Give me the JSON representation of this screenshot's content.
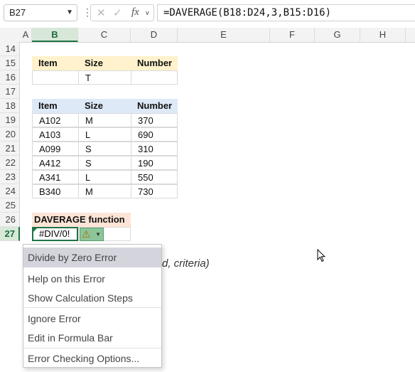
{
  "namebox": {
    "value": "B27"
  },
  "formula_bar": {
    "formula": "=DAVERAGE(B18:D24,3,B15:D16)",
    "fx_label": "fx"
  },
  "columns": [
    "A",
    "B",
    "C",
    "D",
    "E",
    "F",
    "G",
    "H"
  ],
  "rows": [
    "14",
    "15",
    "16",
    "17",
    "18",
    "19",
    "20",
    "21",
    "22",
    "23",
    "24",
    "25",
    "26",
    "27"
  ],
  "criteria_table": {
    "headers": [
      "Item",
      "Size",
      "Number"
    ],
    "row": [
      "",
      "T",
      ""
    ]
  },
  "data_table": {
    "headers": [
      "Item",
      "Size",
      "Number"
    ],
    "rows": [
      [
        "A102",
        "M",
        "370"
      ],
      [
        "A103",
        "L",
        "690"
      ],
      [
        "A099",
        "S",
        "310"
      ],
      [
        "A412",
        "S",
        "190"
      ],
      [
        "A341",
        "L",
        "550"
      ],
      [
        "B340",
        "M",
        "730"
      ]
    ]
  },
  "function_label": "DAVERAGE function",
  "active_cell_value": "#DIV/0!",
  "background_text": "d, criteria)",
  "error_menu": {
    "title": "Divide by Zero Error",
    "items": [
      "Help on this Error",
      "Show Calculation Steps",
      "Ignore Error",
      "Edit in Formula Bar",
      "Error Checking Options..."
    ]
  },
  "colors": {
    "accent": "#217346",
    "criteria_header": "#fff2cc",
    "data_header": "#dde9f7",
    "function_header": "#fce4d6"
  }
}
